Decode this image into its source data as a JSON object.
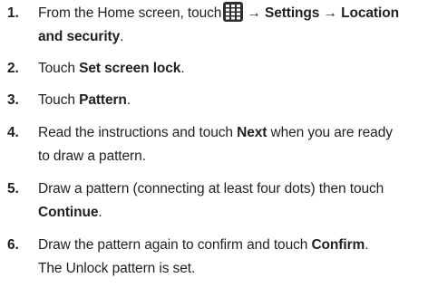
{
  "steps": [
    {
      "number": "1.",
      "line1_a": "From the Home screen, touch",
      "arrow1": "→",
      "settings": "Settings",
      "arrow2": "→",
      "location": "Location",
      "line2": "and security",
      "line2_end": ".",
      "icon": "apps-grid-icon"
    },
    {
      "number": "2.",
      "pre": "Touch ",
      "bold": "Set screen lock",
      "post": "."
    },
    {
      "number": "3.",
      "pre": "Touch ",
      "bold": "Pattern",
      "post": "."
    },
    {
      "number": "4.",
      "pre": "Read the instructions and touch ",
      "bold": "Next",
      "post": " when you are ready",
      "line2": "to draw a pattern."
    },
    {
      "number": "5.",
      "line1": "Draw a pattern (connecting at least four dots) then touch",
      "bold": "Continue",
      "post": "."
    },
    {
      "number": "6.",
      "pre": "Draw the pattern again to confirm and touch ",
      "bold": "Confirm",
      "post": ".",
      "line2": "The Unlock pattern is set."
    }
  ]
}
